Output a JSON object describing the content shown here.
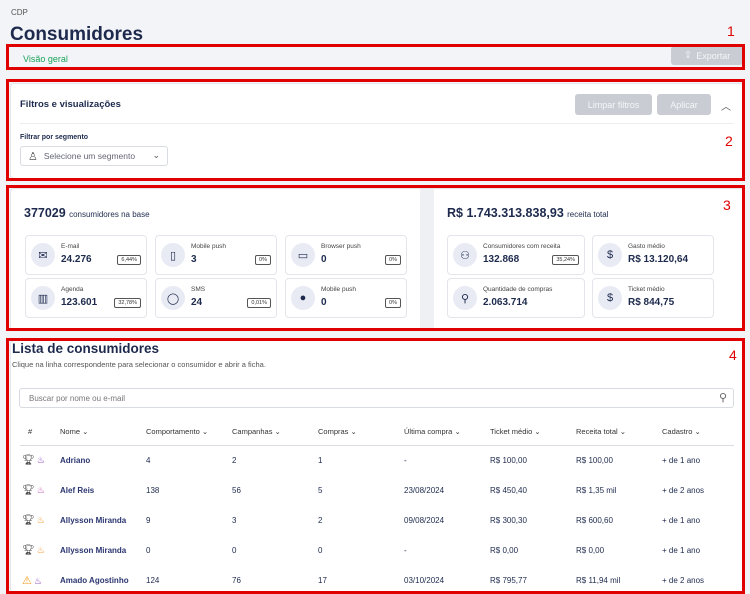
{
  "breadcrumb": "CDP",
  "page_title": "Consumidores",
  "tabs": {
    "overview": "Visão geral"
  },
  "actions": {
    "export": "Exportar"
  },
  "filters": {
    "title": "Filtros e visualizações",
    "clear": "Limpar filtros",
    "apply": "Aplicar",
    "segment_label": "Filtrar por segmento",
    "segment_placeholder": "Selecione um segmento"
  },
  "stats_left": {
    "count": "377029",
    "count_suffix": "consumidores na base",
    "items": [
      {
        "icon": "mail-icon",
        "label": "E-mail",
        "value": "24.276",
        "pct": "6,44%"
      },
      {
        "icon": "mobile-push-icon",
        "label": "Mobile push",
        "value": "3",
        "pct": "0%"
      },
      {
        "icon": "browser-push-icon",
        "label": "Browser push",
        "value": "0",
        "pct": "0%"
      },
      {
        "icon": "agenda-icon",
        "label": "Agenda",
        "value": "123.601",
        "pct": "32,78%"
      },
      {
        "icon": "sms-icon",
        "label": "SMS",
        "value": "24",
        "pct": "0,01%"
      },
      {
        "icon": "apple-icon",
        "label": "Mobile push",
        "value": "0",
        "pct": "0%"
      }
    ]
  },
  "stats_right": {
    "revenue": "R$ 1.743.313.838,93",
    "revenue_suffix": "receita total",
    "items": [
      {
        "icon": "users-icon",
        "label": "Consumidores com receita",
        "value": "132.868",
        "pct": "35,24%"
      },
      {
        "icon": "coin-icon",
        "label": "Gasto médio",
        "value": "R$ 13.120,64"
      },
      {
        "icon": "bag-icon",
        "label": "Quantidade de compras",
        "value": "2.063.714"
      },
      {
        "icon": "coin-icon",
        "label": "Ticket médio",
        "value": "R$ 844,75"
      }
    ]
  },
  "list": {
    "title": "Lista de consumidores",
    "subtitle": "Clique na linha correspondente para selecionar o consumidor e abrir a ficha.",
    "search_placeholder": "Buscar por nome ou e-mail",
    "columns": [
      "#",
      "Nome",
      "Comportamento",
      "Campanhas",
      "Compras",
      "Última compra",
      "Ticket médio",
      "Receita total",
      "Cadastro"
    ],
    "rows": [
      {
        "status": "trophy",
        "flame_color": "#7a2fb8",
        "name": "Adriano",
        "behavior": "4",
        "campaigns": "2",
        "purchases": "1",
        "last": "-",
        "ticket": "R$ 100,00",
        "revenue": "R$ 100,00",
        "signup": "+ de 1 ano"
      },
      {
        "status": "trophy",
        "flame_color": "#c23fb0",
        "name": "Alef Reis",
        "behavior": "138",
        "campaigns": "56",
        "purchases": "5",
        "last": "23/08/2024",
        "ticket": "R$ 450,40",
        "revenue": "R$ 1,35 mil",
        "signup": "+ de 2 anos"
      },
      {
        "status": "trophy",
        "flame_color": "#f28c1a",
        "name": "Allysson Miranda",
        "behavior": "9",
        "campaigns": "3",
        "purchases": "2",
        "last": "09/08/2024",
        "ticket": "R$ 300,30",
        "revenue": "R$ 600,60",
        "signup": "+ de 1 ano"
      },
      {
        "status": "trophy",
        "flame_color": "#f28c1a",
        "name": "Allysson Miranda",
        "behavior": "0",
        "campaigns": "0",
        "purchases": "0",
        "last": "-",
        "ticket": "R$ 0,00",
        "revenue": "R$ 0,00",
        "signup": "+ de 1 ano"
      },
      {
        "status": "warning",
        "flame_color": "#7a2fb8",
        "name": "Amado Agostinho",
        "behavior": "124",
        "campaigns": "76",
        "purchases": "17",
        "last": "03/10/2024",
        "ticket": "R$ 795,77",
        "revenue": "R$ 11,94 mil",
        "signup": "+ de 2 anos"
      }
    ]
  },
  "markers": [
    "1",
    "2",
    "3",
    "4"
  ]
}
